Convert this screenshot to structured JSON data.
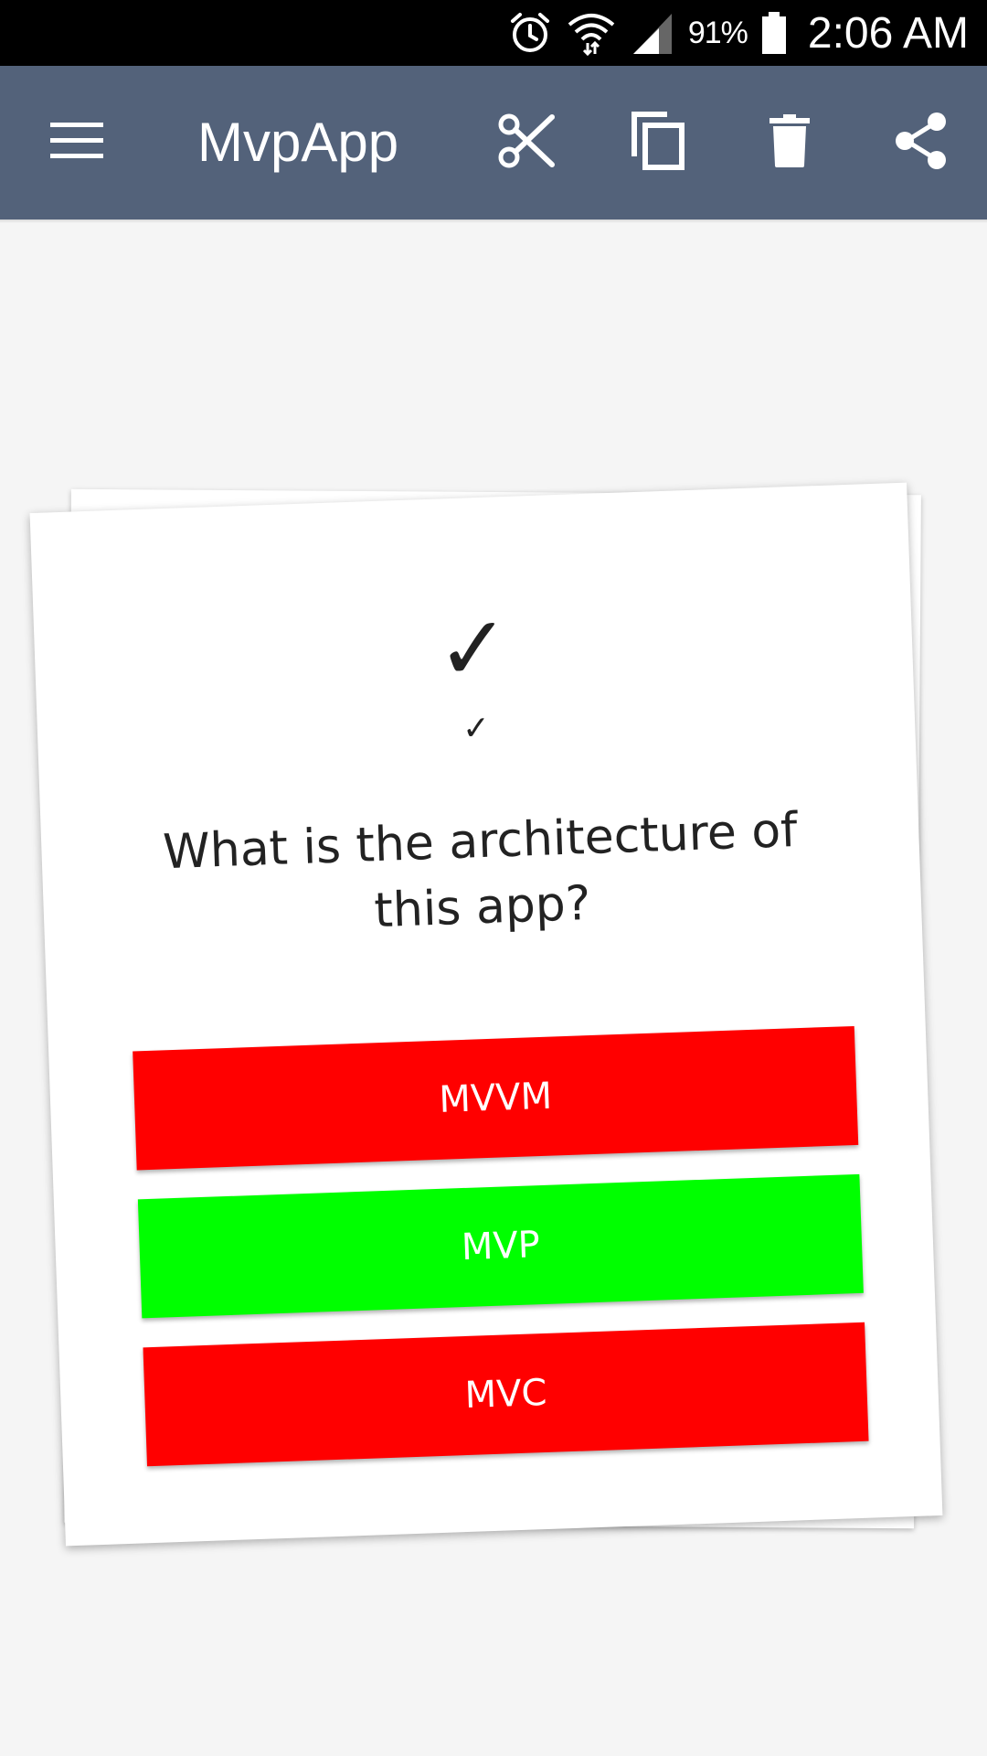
{
  "status_bar": {
    "battery_percent": "91%",
    "time": "2:06 AM",
    "icons": [
      "alarm-icon",
      "wifi-icon",
      "signal-icon",
      "battery-icon"
    ]
  },
  "app_bar": {
    "title": "MvpApp",
    "actions": [
      "menu-icon",
      "cut-icon",
      "copy-icon",
      "delete-icon",
      "share-icon"
    ],
    "color": "#53627a"
  },
  "card": {
    "check_large": "✓",
    "check_small": "✓",
    "question": "What is the architecture of this app?",
    "answers": [
      {
        "label": "MVVM",
        "color": "#ff0000"
      },
      {
        "label": "MVP",
        "color": "#00ff00"
      },
      {
        "label": "MVC",
        "color": "#ff0000"
      }
    ]
  }
}
